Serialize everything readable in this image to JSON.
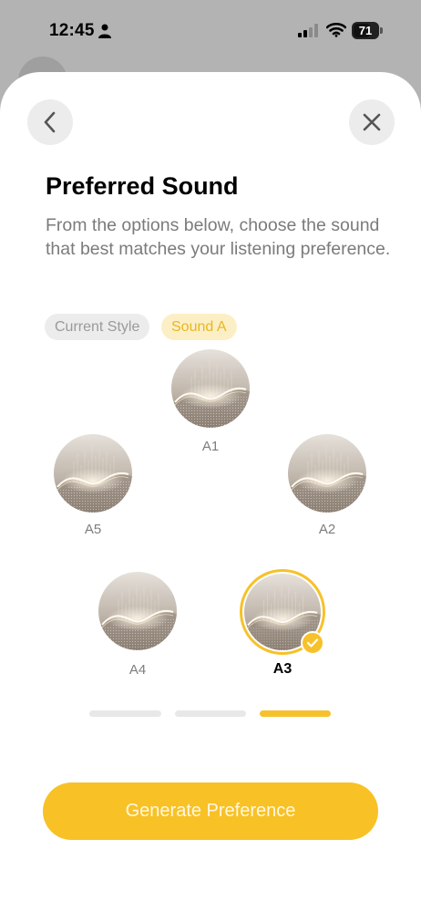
{
  "status_bar": {
    "time": "12:45",
    "battery": "71"
  },
  "header": {
    "back_icon": "chevron-left-icon",
    "close_icon": "close-icon"
  },
  "title": "Preferred Sound",
  "subtitle": "From the options below, choose the sound that best matches your listening preference.",
  "chips": {
    "current": "Current Style",
    "selected": "Sound A"
  },
  "options": [
    {
      "id": "A1",
      "label": "A1",
      "selected": false
    },
    {
      "id": "A5",
      "label": "A5",
      "selected": false
    },
    {
      "id": "A2",
      "label": "A2",
      "selected": false
    },
    {
      "id": "A4",
      "label": "A4",
      "selected": false
    },
    {
      "id": "A3",
      "label": "A3",
      "selected": true
    }
  ],
  "progress": {
    "steps": 3,
    "current": 3
  },
  "cta": {
    "label": "Generate Preference"
  },
  "colors": {
    "accent": "#f6c12a",
    "accent_light": "#fcefc6",
    "muted": "#7b7b7b"
  }
}
